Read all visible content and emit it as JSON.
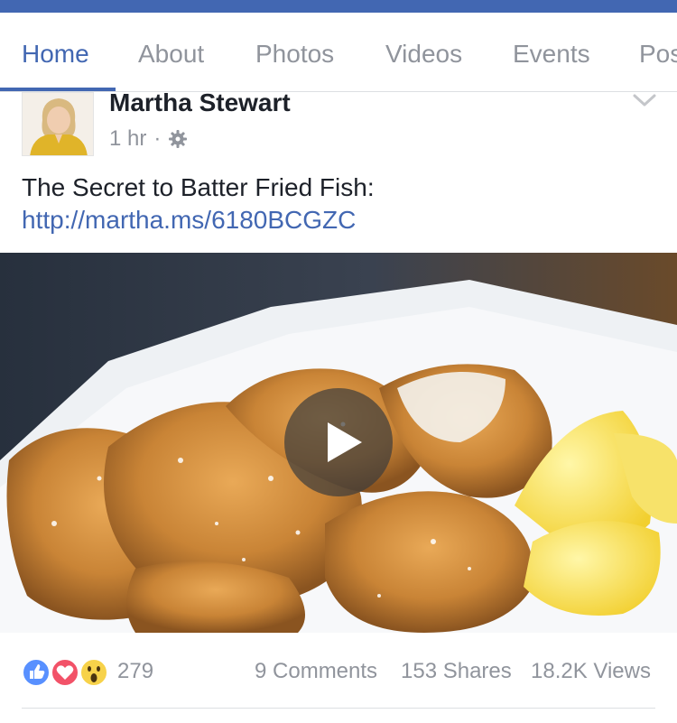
{
  "colors": {
    "brand_blue": "#4267b2",
    "link_blue": "#4267b2",
    "muted_text": "#90949c",
    "primary_text": "#1d2129",
    "like_blue": "#5890ff",
    "love_red": "#f25268",
    "wow_yellow": "#f7d24a"
  },
  "tabs": [
    {
      "label": "Home",
      "active": true
    },
    {
      "label": "About",
      "active": false
    },
    {
      "label": "Photos",
      "active": false
    },
    {
      "label": "Videos",
      "active": false
    },
    {
      "label": "Events",
      "active": false
    },
    {
      "label": "Pos",
      "active": false
    }
  ],
  "post": {
    "author": "Martha Stewart",
    "time": "1 hr",
    "separator": "·",
    "privacy_icon": "gear-icon",
    "menu_icon": "chevron-down-icon",
    "text_prefix": "The Secret to Batter Fried Fish: ",
    "link": "http://martha.ms/6180BCGZC",
    "media_type": "video",
    "media_icon": "play-icon"
  },
  "stats": {
    "reaction_icons": [
      "like-icon",
      "love-icon",
      "wow-icon"
    ],
    "reaction_count": "279",
    "comments": "9 Comments",
    "shares": "153 Shares",
    "views": "18.2K Views"
  }
}
